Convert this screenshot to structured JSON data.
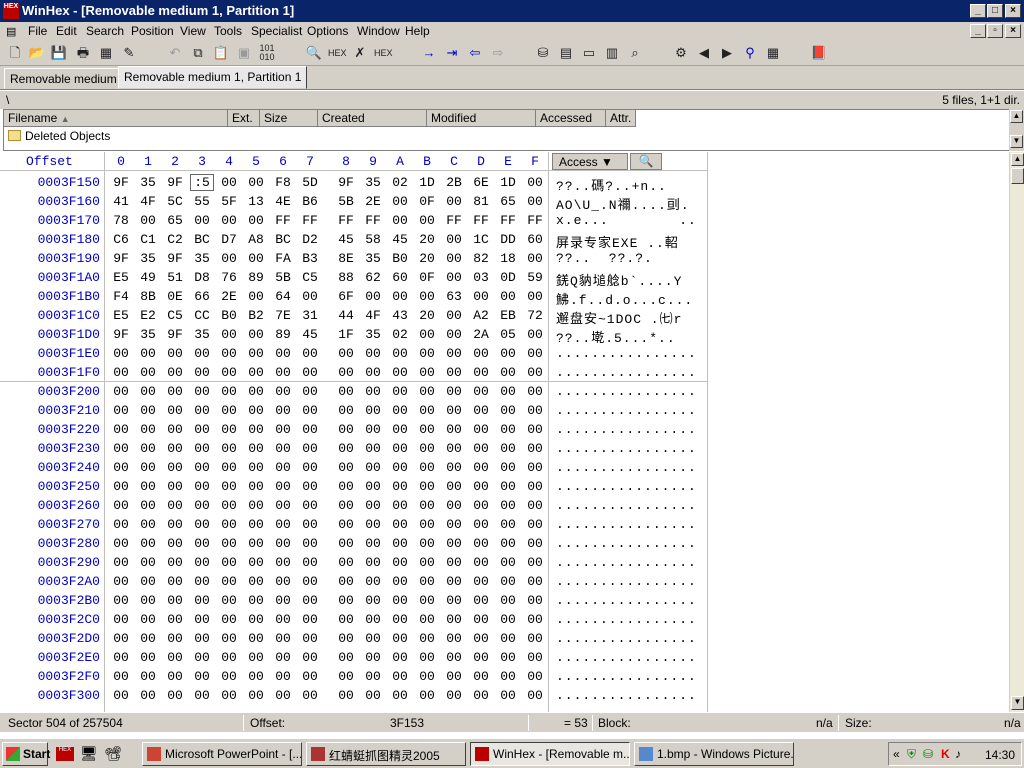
{
  "window": {
    "title": "WinHex - [Removable medium 1, Partition 1]"
  },
  "menu": [
    "File",
    "Edit",
    "Search",
    "Position",
    "View",
    "Tools",
    "Specialist",
    "Options",
    "Window",
    "Help"
  ],
  "tabs": [
    "Removable medium 1",
    "Removable medium 1, Partition 1"
  ],
  "path": {
    "current": "\\",
    "summary": "5 files, 1+1 dir."
  },
  "filelist": {
    "columns": [
      "Filename",
      "Ext.",
      "Size",
      "Created",
      "Modified",
      "Accessed",
      "Attr."
    ],
    "rows": [
      {
        "name": "Deleted Objects"
      }
    ]
  },
  "hex": {
    "offset_label": "Offset",
    "columns": [
      "0",
      "1",
      "2",
      "3",
      "4",
      "5",
      "6",
      "7",
      "8",
      "9",
      "A",
      "B",
      "C",
      "D",
      "E",
      "F"
    ],
    "access_label": "Access",
    "rows": [
      {
        "offset": "0003F150",
        "bytes": [
          "9F",
          "35",
          "9F",
          ":5",
          "00",
          "00",
          "F8",
          "5D",
          "9F",
          "35",
          "02",
          "1D",
          "2B",
          "6E",
          "1D",
          "00"
        ],
        "text": "??..碼?..+n.."
      },
      {
        "offset": "0003F160",
        "bytes": [
          "41",
          "4F",
          "5C",
          "55",
          "5F",
          "13",
          "4E",
          "B6",
          "5B",
          "2E",
          "00",
          "0F",
          "00",
          "81",
          "65",
          "00"
        ],
        "text": "AO\\U_.N禰....刯."
      },
      {
        "offset": "0003F170",
        "bytes": [
          "78",
          "00",
          "65",
          "00",
          "00",
          "00",
          "FF",
          "FF",
          "FF",
          "FF",
          "00",
          "00",
          "FF",
          "FF",
          "FF",
          "FF"
        ],
        "text": "x.e...        .."
      },
      {
        "offset": "0003F180",
        "bytes": [
          "C6",
          "C1",
          "C2",
          "BC",
          "D7",
          "A8",
          "BC",
          "D2",
          "45",
          "58",
          "45",
          "20",
          "00",
          "1C",
          "DD",
          "60"
        ],
        "text": "屏录专家EXE ..軺"
      },
      {
        "offset": "0003F190",
        "bytes": [
          "9F",
          "35",
          "9F",
          "35",
          "00",
          "00",
          "FA",
          "B3",
          "8E",
          "35",
          "B0",
          "20",
          "00",
          "82",
          "18",
          "00"
        ],
        "text": "??..  ??.?."
      },
      {
        "offset": "0003F1A0",
        "bytes": [
          "E5",
          "49",
          "51",
          "D8",
          "76",
          "89",
          "5B",
          "C5",
          "88",
          "62",
          "60",
          "0F",
          "00",
          "03",
          "0D",
          "59"
        ],
        "text": "錓Q豽塠艌b`....Y"
      },
      {
        "offset": "0003F1B0",
        "bytes": [
          "F4",
          "8B",
          "0E",
          "66",
          "2E",
          "00",
          "64",
          "00",
          "6F",
          "00",
          "00",
          "00",
          "63",
          "00",
          "00",
          "00"
        ],
        "text": "鮄.f..d.o...c..."
      },
      {
        "offset": "0003F1C0",
        "bytes": [
          "E5",
          "E2",
          "C5",
          "CC",
          "B0",
          "B2",
          "7E",
          "31",
          "44",
          "4F",
          "43",
          "20",
          "00",
          "A2",
          "EB",
          "72"
        ],
        "text": "邂盘安~1DOC .㈦r"
      },
      {
        "offset": "0003F1D0",
        "bytes": [
          "9F",
          "35",
          "9F",
          "35",
          "00",
          "00",
          "89",
          "45",
          "1F",
          "35",
          "02",
          "00",
          "00",
          "2A",
          "05",
          "00"
        ],
        "text": "??..墘.5...*.."
      },
      {
        "offset": "0003F1E0",
        "bytes": [
          "00",
          "00",
          "00",
          "00",
          "00",
          "00",
          "00",
          "00",
          "00",
          "00",
          "00",
          "00",
          "00",
          "00",
          "00",
          "00"
        ],
        "text": "................"
      },
      {
        "offset": "0003F1F0",
        "bytes": [
          "00",
          "00",
          "00",
          "00",
          "00",
          "00",
          "00",
          "00",
          "00",
          "00",
          "00",
          "00",
          "00",
          "00",
          "00",
          "00"
        ],
        "text": "................"
      },
      {
        "offset": "0003F200",
        "bytes": [
          "00",
          "00",
          "00",
          "00",
          "00",
          "00",
          "00",
          "00",
          "00",
          "00",
          "00",
          "00",
          "00",
          "00",
          "00",
          "00"
        ],
        "text": "................"
      },
      {
        "offset": "0003F210",
        "bytes": [
          "00",
          "00",
          "00",
          "00",
          "00",
          "00",
          "00",
          "00",
          "00",
          "00",
          "00",
          "00",
          "00",
          "00",
          "00",
          "00"
        ],
        "text": "................"
      },
      {
        "offset": "0003F220",
        "bytes": [
          "00",
          "00",
          "00",
          "00",
          "00",
          "00",
          "00",
          "00",
          "00",
          "00",
          "00",
          "00",
          "00",
          "00",
          "00",
          "00"
        ],
        "text": "................"
      },
      {
        "offset": "0003F230",
        "bytes": [
          "00",
          "00",
          "00",
          "00",
          "00",
          "00",
          "00",
          "00",
          "00",
          "00",
          "00",
          "00",
          "00",
          "00",
          "00",
          "00"
        ],
        "text": "................"
      },
      {
        "offset": "0003F240",
        "bytes": [
          "00",
          "00",
          "00",
          "00",
          "00",
          "00",
          "00",
          "00",
          "00",
          "00",
          "00",
          "00",
          "00",
          "00",
          "00",
          "00"
        ],
        "text": "................"
      },
      {
        "offset": "0003F250",
        "bytes": [
          "00",
          "00",
          "00",
          "00",
          "00",
          "00",
          "00",
          "00",
          "00",
          "00",
          "00",
          "00",
          "00",
          "00",
          "00",
          "00"
        ],
        "text": "................"
      },
      {
        "offset": "0003F260",
        "bytes": [
          "00",
          "00",
          "00",
          "00",
          "00",
          "00",
          "00",
          "00",
          "00",
          "00",
          "00",
          "00",
          "00",
          "00",
          "00",
          "00"
        ],
        "text": "................"
      },
      {
        "offset": "0003F270",
        "bytes": [
          "00",
          "00",
          "00",
          "00",
          "00",
          "00",
          "00",
          "00",
          "00",
          "00",
          "00",
          "00",
          "00",
          "00",
          "00",
          "00"
        ],
        "text": "................"
      },
      {
        "offset": "0003F280",
        "bytes": [
          "00",
          "00",
          "00",
          "00",
          "00",
          "00",
          "00",
          "00",
          "00",
          "00",
          "00",
          "00",
          "00",
          "00",
          "00",
          "00"
        ],
        "text": "................"
      },
      {
        "offset": "0003F290",
        "bytes": [
          "00",
          "00",
          "00",
          "00",
          "00",
          "00",
          "00",
          "00",
          "00",
          "00",
          "00",
          "00",
          "00",
          "00",
          "00",
          "00"
        ],
        "text": "................"
      },
      {
        "offset": "0003F2A0",
        "bytes": [
          "00",
          "00",
          "00",
          "00",
          "00",
          "00",
          "00",
          "00",
          "00",
          "00",
          "00",
          "00",
          "00",
          "00",
          "00",
          "00"
        ],
        "text": "................"
      },
      {
        "offset": "0003F2B0",
        "bytes": [
          "00",
          "00",
          "00",
          "00",
          "00",
          "00",
          "00",
          "00",
          "00",
          "00",
          "00",
          "00",
          "00",
          "00",
          "00",
          "00"
        ],
        "text": "................"
      },
      {
        "offset": "0003F2C0",
        "bytes": [
          "00",
          "00",
          "00",
          "00",
          "00",
          "00",
          "00",
          "00",
          "00",
          "00",
          "00",
          "00",
          "00",
          "00",
          "00",
          "00"
        ],
        "text": "................"
      },
      {
        "offset": "0003F2D0",
        "bytes": [
          "00",
          "00",
          "00",
          "00",
          "00",
          "00",
          "00",
          "00",
          "00",
          "00",
          "00",
          "00",
          "00",
          "00",
          "00",
          "00"
        ],
        "text": "................"
      },
      {
        "offset": "0003F2E0",
        "bytes": [
          "00",
          "00",
          "00",
          "00",
          "00",
          "00",
          "00",
          "00",
          "00",
          "00",
          "00",
          "00",
          "00",
          "00",
          "00",
          "00"
        ],
        "text": "................"
      },
      {
        "offset": "0003F2F0",
        "bytes": [
          "00",
          "00",
          "00",
          "00",
          "00",
          "00",
          "00",
          "00",
          "00",
          "00",
          "00",
          "00",
          "00",
          "00",
          "00",
          "00"
        ],
        "text": "................"
      },
      {
        "offset": "0003F300",
        "bytes": [
          "00",
          "00",
          "00",
          "00",
          "00",
          "00",
          "00",
          "00",
          "00",
          "00",
          "00",
          "00",
          "00",
          "00",
          "00",
          "00"
        ],
        "text": "................"
      }
    ]
  },
  "status": {
    "sector": "Sector 504 of 257504",
    "offset_label": "Offset:",
    "offset_value": "3F153",
    "value": "= 53",
    "block_label": "Block:",
    "block_value": "n/a",
    "size_label": "Size:",
    "size_value": "n/a"
  },
  "taskbar": {
    "start": "Start",
    "tasks": [
      "Microsoft PowerPoint - [...",
      "红蜻蜓抓图精灵2005",
      "WinHex - [Removable m...",
      "1.bmp - Windows Picture..."
    ],
    "clock": "14:30"
  },
  "colors": {
    "title_bg": "#0a246a",
    "offset_color": "#0000c0"
  }
}
